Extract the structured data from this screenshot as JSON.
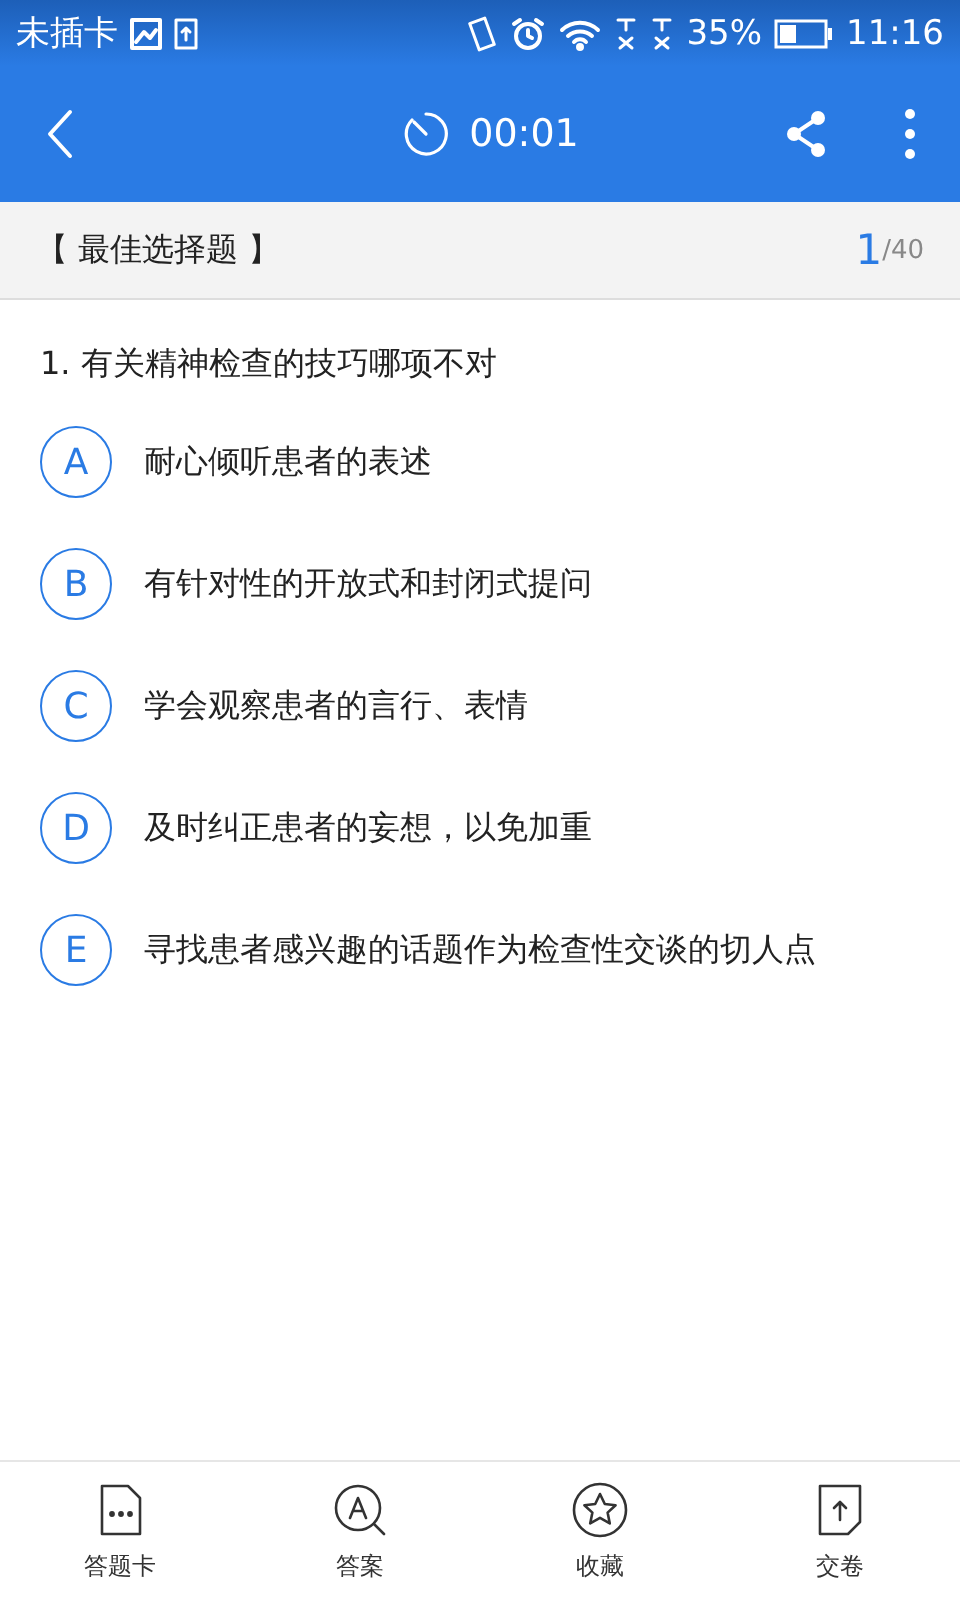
{
  "status_bar": {
    "carrier": "未插卡",
    "battery": "35%",
    "time": "11:16"
  },
  "header": {
    "timer": "00:01"
  },
  "section": {
    "title": "【 最佳选择题 】",
    "current": "1",
    "total": "/40"
  },
  "question": {
    "text": "1. 有关精神检查的技巧哪项不对",
    "options": [
      {
        "letter": "A",
        "text": "耐心倾听患者的表述"
      },
      {
        "letter": "B",
        "text": "有针对性的开放式和封闭式提问"
      },
      {
        "letter": "C",
        "text": "学会观察患者的言行、表情"
      },
      {
        "letter": "D",
        "text": "及时纠正患者的妄想，以免加重"
      },
      {
        "letter": "E",
        "text": "寻找患者感兴趣的话题作为检查性交谈的切人点"
      }
    ]
  },
  "bottom_bar": [
    {
      "kind": "card",
      "label": "答题卡"
    },
    {
      "kind": "answer",
      "label": "答案"
    },
    {
      "kind": "favorite",
      "label": "收藏"
    },
    {
      "kind": "submit",
      "label": "交卷"
    }
  ]
}
